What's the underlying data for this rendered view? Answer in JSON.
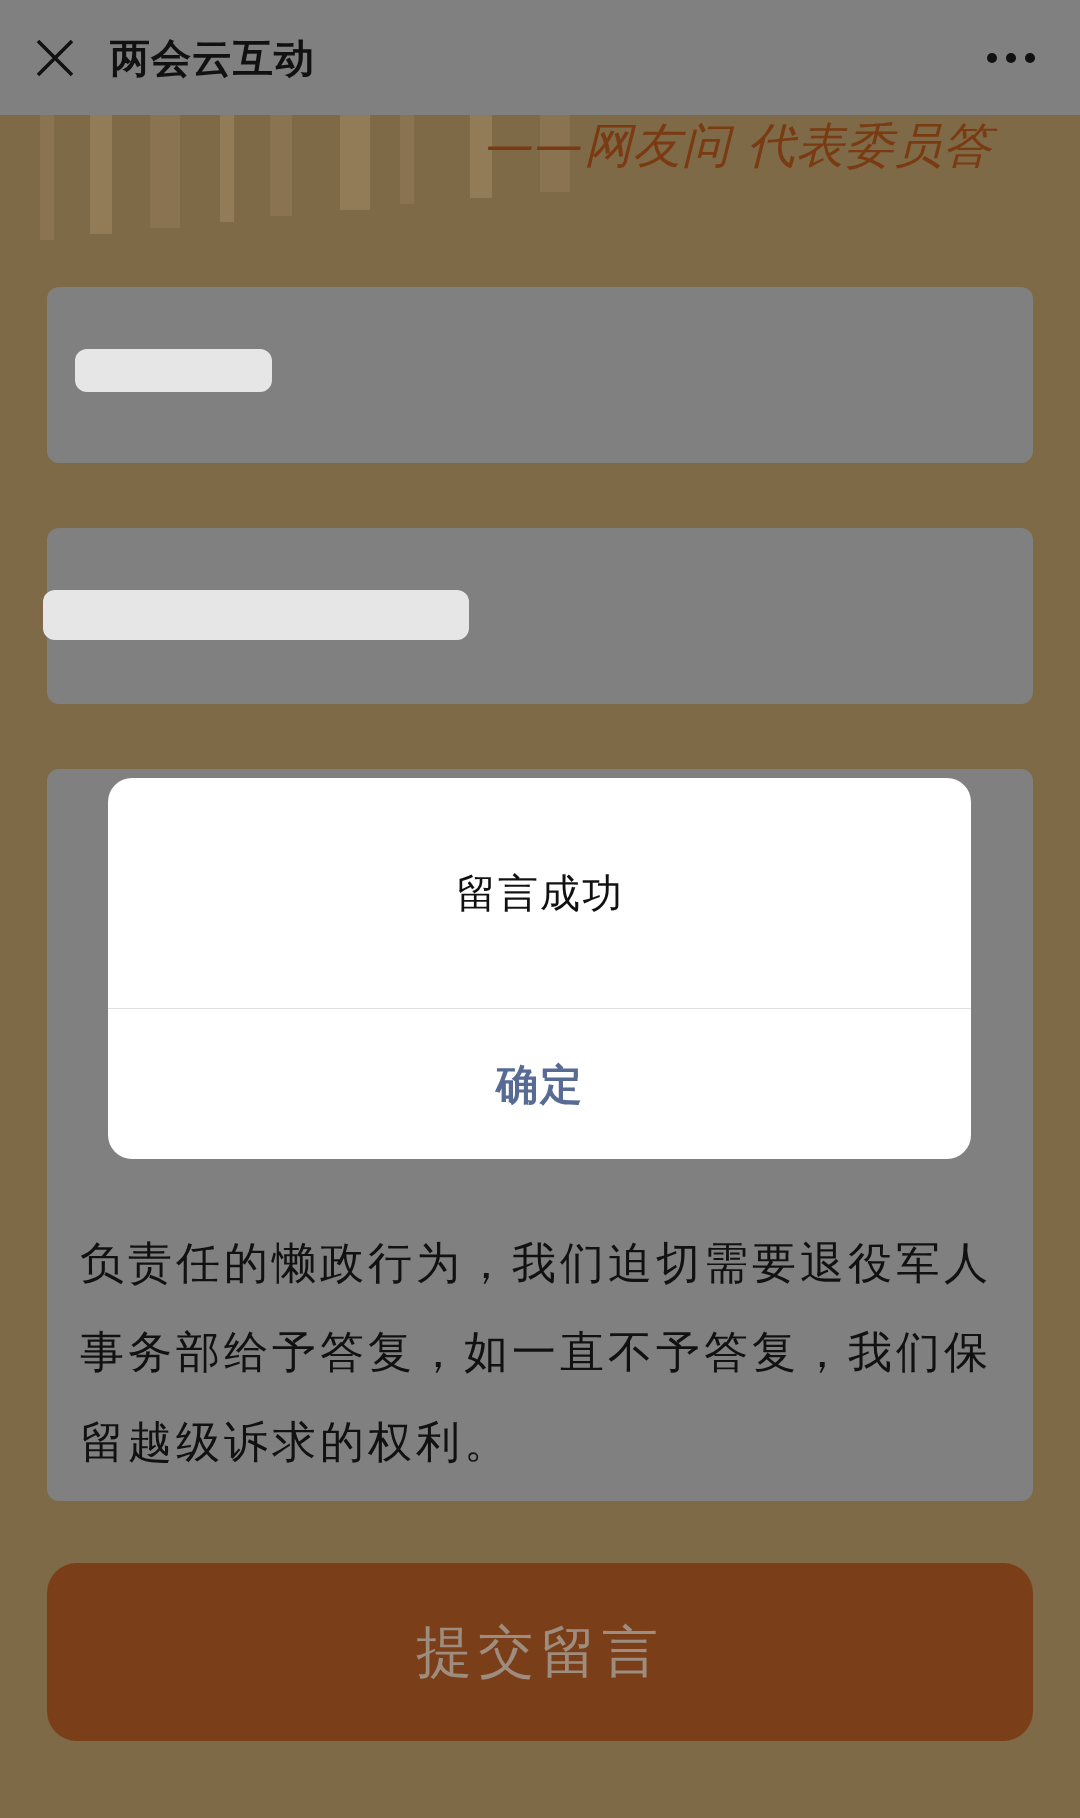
{
  "nav": {
    "title": "两会云互动",
    "close_icon": true,
    "more_icon": true
  },
  "banner": {
    "kind": "picture",
    "slogan": "——网友问 代表委员答"
  },
  "fields": [
    {
      "redacted": true
    },
    {
      "redacted": true
    }
  ],
  "message_lines": [
    {
      "left": "负责任的懒政行为，我们迫切需要退役军人"
    },
    {
      "left": "事务部给予答复，如一直不予答复，我们保"
    },
    {
      "left": "留越级诉求的权利。"
    }
  ],
  "submit_button": {
    "label": "提交留言",
    "disabled": true
  },
  "dialog": {
    "message": "留言成功",
    "confirm": "确定"
  }
}
